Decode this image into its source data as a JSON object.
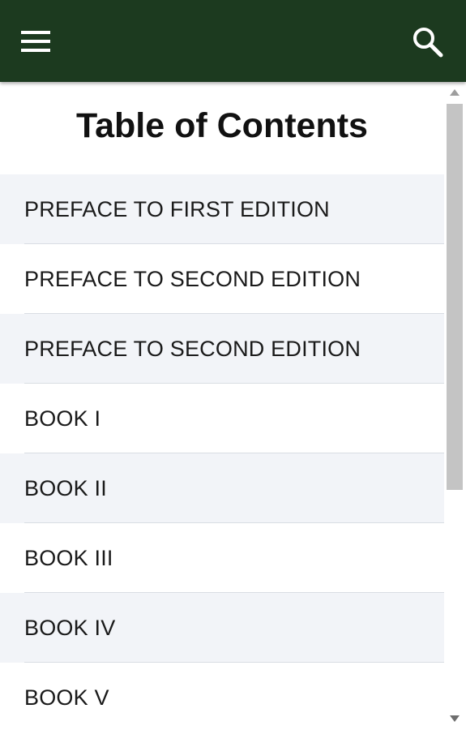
{
  "header": {
    "background": "#1c3a1f",
    "menu_icon": "hamburger-menu-icon",
    "search_icon": "search-icon"
  },
  "page": {
    "title": "Table of Contents"
  },
  "toc": {
    "items": [
      {
        "label": "PREFACE TO FIRST EDITION"
      },
      {
        "label": "PREFACE TO SECOND EDITION"
      },
      {
        "label": "PREFACE TO SECOND EDITION"
      },
      {
        "label": "BOOK I"
      },
      {
        "label": "BOOK II"
      },
      {
        "label": "BOOK III"
      },
      {
        "label": "BOOK IV"
      },
      {
        "label": "BOOK V"
      }
    ]
  },
  "colors": {
    "shaded_row": "#f2f4f8",
    "text": "#1a1a1a"
  }
}
